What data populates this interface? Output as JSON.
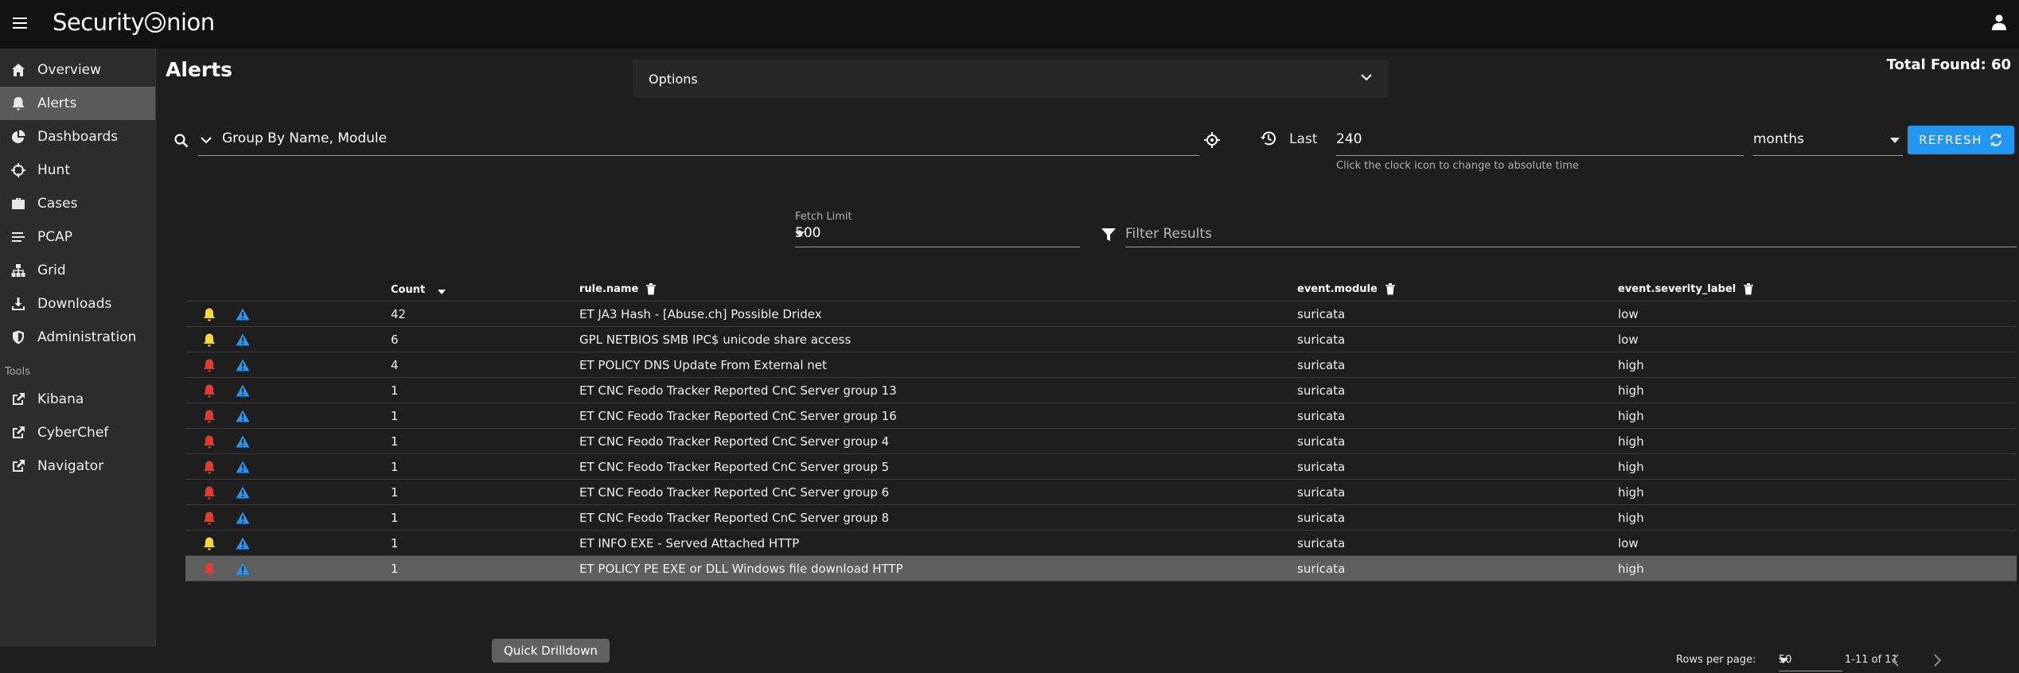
{
  "brand": {
    "name_part1": "Security",
    "name_part2": "nion"
  },
  "sidebar": {
    "items": [
      {
        "label": "Overview",
        "icon": "home-icon"
      },
      {
        "label": "Alerts",
        "icon": "bell-icon",
        "active": true
      },
      {
        "label": "Dashboards",
        "icon": "pie-chart-icon"
      },
      {
        "label": "Hunt",
        "icon": "crosshairs-icon"
      },
      {
        "label": "Cases",
        "icon": "briefcase-icon"
      },
      {
        "label": "PCAP",
        "icon": "stream-icon"
      },
      {
        "label": "Grid",
        "icon": "sitemap-icon"
      },
      {
        "label": "Downloads",
        "icon": "download-icon"
      },
      {
        "label": "Administration",
        "icon": "shield-icon"
      }
    ],
    "tools_heading": "Tools",
    "tools": [
      {
        "label": "Kibana",
        "icon": "external-link-icon"
      },
      {
        "label": "CyberChef",
        "icon": "external-link-icon"
      },
      {
        "label": "Navigator",
        "icon": "external-link-icon"
      }
    ]
  },
  "header": {
    "title": "Alerts",
    "options_label": "Options",
    "total_found": "Total Found: 60"
  },
  "query": {
    "text": "Group By Name, Module",
    "last_label": "Last",
    "last_value": "240",
    "last_hint": "Click the clock icon to change to absolute time",
    "unit": "months",
    "refresh_label": "REFRESH"
  },
  "fetch": {
    "label": "Fetch Limit",
    "value": "500"
  },
  "filter": {
    "placeholder": "Filter Results"
  },
  "table": {
    "headers": {
      "count": "Count",
      "rule": "rule.name",
      "module": "event.module",
      "severity": "event.severity_label"
    },
    "rows": [
      {
        "count": "42",
        "rule": "ET JA3 Hash - [Abuse.ch] Possible Dridex",
        "module": "suricata",
        "severity": "low"
      },
      {
        "count": "6",
        "rule": "GPL NETBIOS SMB IPC$ unicode share access",
        "module": "suricata",
        "severity": "low"
      },
      {
        "count": "4",
        "rule": "ET POLICY DNS Update From External net",
        "module": "suricata",
        "severity": "high"
      },
      {
        "count": "1",
        "rule": "ET CNC Feodo Tracker Reported CnC Server group 13",
        "module": "suricata",
        "severity": "high"
      },
      {
        "count": "1",
        "rule": "ET CNC Feodo Tracker Reported CnC Server group 16",
        "module": "suricata",
        "severity": "high"
      },
      {
        "count": "1",
        "rule": "ET CNC Feodo Tracker Reported CnC Server group 4",
        "module": "suricata",
        "severity": "high"
      },
      {
        "count": "1",
        "rule": "ET CNC Feodo Tracker Reported CnC Server group 5",
        "module": "suricata",
        "severity": "high"
      },
      {
        "count": "1",
        "rule": "ET CNC Feodo Tracker Reported CnC Server group 6",
        "module": "suricata",
        "severity": "high"
      },
      {
        "count": "1",
        "rule": "ET CNC Feodo Tracker Reported CnC Server group 8",
        "module": "suricata",
        "severity": "high"
      },
      {
        "count": "1",
        "rule": "ET INFO EXE - Served Attached HTTP",
        "module": "suricata",
        "severity": "low"
      },
      {
        "count": "1",
        "rule": "ET POLICY PE EXE or DLL Windows file download HTTP",
        "module": "suricata",
        "severity": "high"
      }
    ],
    "highlighted_row": 10
  },
  "tooltip": {
    "text": "Quick Drilldown"
  },
  "pager": {
    "rows_per_page_label": "Rows per page:",
    "rows_per_page": "50",
    "range": "1-11 of 11"
  },
  "colors": {
    "accent": "#2196f3",
    "severity_low": "#fdd835",
    "severity_high": "#e53935",
    "warning_icon": "#2196f3"
  }
}
